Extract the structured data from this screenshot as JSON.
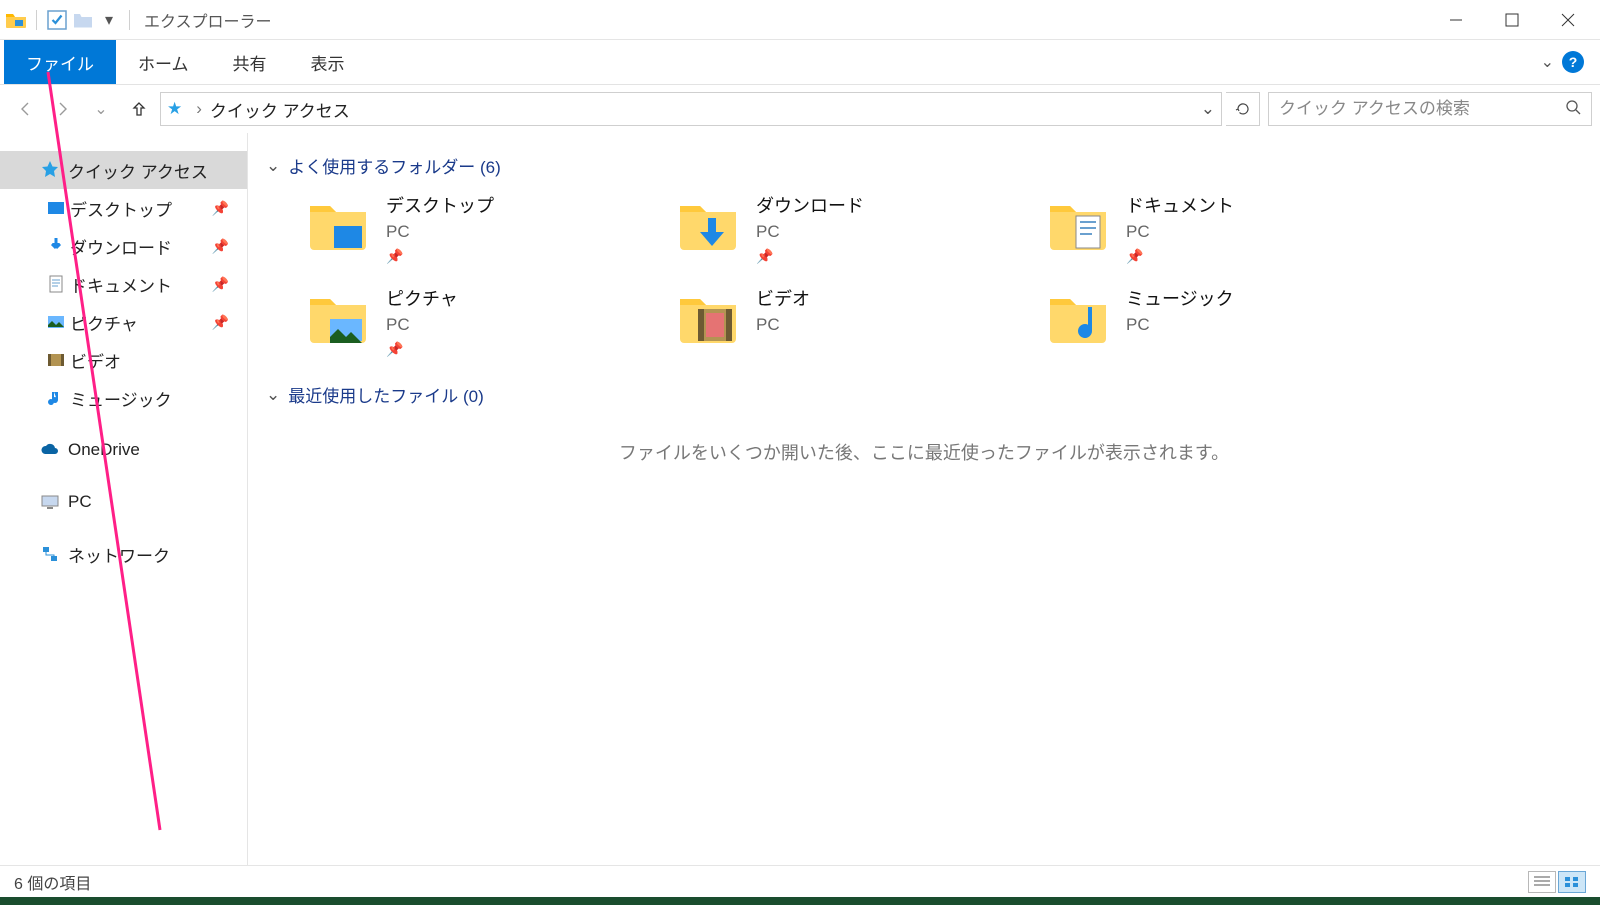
{
  "window": {
    "title": "エクスプローラー"
  },
  "ribbon": {
    "file": "ファイル",
    "home": "ホーム",
    "share": "共有",
    "view": "表示",
    "help": "?"
  },
  "address": {
    "path_root": "クイック アクセス",
    "search_placeholder": "クイック アクセスの検索"
  },
  "sidebar": {
    "quick_access": "クイック アクセス",
    "items": [
      {
        "label": "デスクトップ",
        "pinned": true
      },
      {
        "label": "ダウンロード",
        "pinned": true
      },
      {
        "label": "ドキュメント",
        "pinned": true
      },
      {
        "label": "ピクチャ",
        "pinned": true
      },
      {
        "label": "ビデオ",
        "pinned": false
      },
      {
        "label": "ミュージック",
        "pinned": false
      }
    ],
    "onedrive": "OneDrive",
    "pc": "PC",
    "network": "ネットワーク"
  },
  "content": {
    "section_folders_label": "よく使用するフォルダー (6)",
    "section_recent_label": "最近使用したファイル (0)",
    "empty_recent": "ファイルをいくつか開いた後、ここに最近使ったファイルが表示されます。",
    "folders": [
      {
        "name": "デスクトップ",
        "sub": "PC",
        "pinned": true
      },
      {
        "name": "ダウンロード",
        "sub": "PC",
        "pinned": true
      },
      {
        "name": "ドキュメント",
        "sub": "PC",
        "pinned": true
      },
      {
        "name": "ピクチャ",
        "sub": "PC",
        "pinned": true
      },
      {
        "name": "ビデオ",
        "sub": "PC",
        "pinned": false
      },
      {
        "name": "ミュージック",
        "sub": "PC",
        "pinned": false
      }
    ]
  },
  "statusbar": {
    "items": "6 個の項目"
  }
}
